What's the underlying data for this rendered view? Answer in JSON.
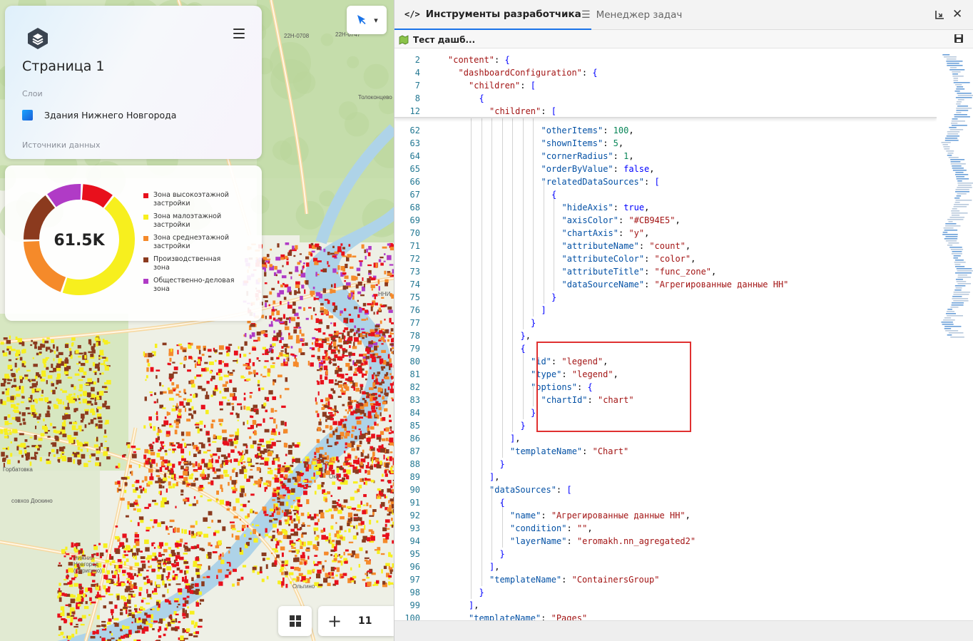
{
  "map": {
    "labels": [
      "22H-0708",
      "22H-0747",
      "Толоконцево",
      "Горбатовка",
      "совхоз Доскино",
      "Нижний Новгород (Стригино)",
      "Ока",
      "Ольгино",
      "ННИ"
    ]
  },
  "layers_panel": {
    "page_title": "Страница 1",
    "layers_label": "Слои",
    "layer_name": "Здания Нижнего Новгорода",
    "sources_label": "Источники данных"
  },
  "chart_panel": {
    "center_value": "61.5K",
    "chart_data": {
      "type": "pie",
      "title": "",
      "categories": [
        "Зона высокоэтажной застройки",
        "Зона малоэтажной застройки",
        "Зона среднеэтажной застройки",
        "Производственная зона",
        "Общественно-деловая зона"
      ],
      "values": [
        9,
        41,
        18,
        14,
        10
      ],
      "colors": [
        "#e8101c",
        "#f7ef1e",
        "#f58a2a",
        "#8b3a1e",
        "#b03bc6"
      ],
      "center_label": "61.5K"
    },
    "legend": [
      {
        "label": "Зона высокоэтажной застройки",
        "color": "#e8101c"
      },
      {
        "label": "Зона малоэтажной застройки",
        "color": "#f7ef1e"
      },
      {
        "label": "Зона среднеэтажной застройки",
        "color": "#f58a2a"
      },
      {
        "label": "Производственная зона",
        "color": "#8b3a1e"
      },
      {
        "label": "Общественно-деловая зона",
        "color": "#b03bc6"
      }
    ]
  },
  "map_controls": {
    "zoom_level": "11",
    "zoom_plus": "+",
    "tool_dropdown": "▾"
  },
  "devtools": {
    "tab_devtools": "Инструменты разработчика",
    "tab_tasks": "Менеджер задач",
    "file_tab": "Тест дашб...",
    "close": "✕"
  },
  "editor": {
    "sticky": [
      {
        "ln": "2",
        "ind": 2,
        "t": [
          [
            "s",
            "\"content\""
          ],
          [
            "p",
            ": "
          ],
          [
            "b",
            "{"
          ]
        ]
      },
      {
        "ln": "4",
        "ind": 3,
        "t": [
          [
            "s",
            "\"dashboardConfiguration\""
          ],
          [
            "p",
            ": "
          ],
          [
            "b",
            "{"
          ]
        ]
      },
      {
        "ln": "7",
        "ind": 4,
        "t": [
          [
            "s",
            "\"children\""
          ],
          [
            "p",
            ": "
          ],
          [
            "b",
            "["
          ]
        ]
      },
      {
        "ln": "8",
        "ind": 5,
        "t": [
          [
            "b",
            "{"
          ]
        ]
      },
      {
        "ln": "12",
        "ind": 6,
        "t": [
          [
            "s",
            "\"children\""
          ],
          [
            "p",
            ": "
          ],
          [
            "b",
            "["
          ]
        ]
      }
    ],
    "lines": [
      {
        "ln": "62",
        "ind": 11,
        "t": [
          [
            "k",
            "\"otherItems\""
          ],
          [
            "p",
            ": "
          ],
          [
            "n",
            "100"
          ],
          [
            "p",
            ","
          ]
        ]
      },
      {
        "ln": "63",
        "ind": 11,
        "t": [
          [
            "k",
            "\"shownItems\""
          ],
          [
            "p",
            ": "
          ],
          [
            "n",
            "5"
          ],
          [
            "p",
            ","
          ]
        ]
      },
      {
        "ln": "64",
        "ind": 11,
        "t": [
          [
            "k",
            "\"cornerRadius\""
          ],
          [
            "p",
            ": "
          ],
          [
            "n",
            "1"
          ],
          [
            "p",
            ","
          ]
        ]
      },
      {
        "ln": "65",
        "ind": 11,
        "t": [
          [
            "k",
            "\"orderByValue\""
          ],
          [
            "p",
            ": "
          ],
          [
            "b",
            "false"
          ],
          [
            "p",
            ","
          ]
        ]
      },
      {
        "ln": "66",
        "ind": 11,
        "t": [
          [
            "k",
            "\"relatedDataSources\""
          ],
          [
            "p",
            ": "
          ],
          [
            "b",
            "["
          ]
        ]
      },
      {
        "ln": "67",
        "ind": 12,
        "t": [
          [
            "b",
            "{"
          ]
        ]
      },
      {
        "ln": "68",
        "ind": 13,
        "t": [
          [
            "k",
            "\"hideAxis\""
          ],
          [
            "p",
            ": "
          ],
          [
            "b",
            "true"
          ],
          [
            "p",
            ","
          ]
        ]
      },
      {
        "ln": "69",
        "ind": 13,
        "t": [
          [
            "k",
            "\"axisColor\""
          ],
          [
            "p",
            ": "
          ],
          [
            "s",
            "\"#CB94E5\""
          ],
          [
            "p",
            ","
          ]
        ]
      },
      {
        "ln": "70",
        "ind": 13,
        "t": [
          [
            "k",
            "\"chartAxis\""
          ],
          [
            "p",
            ": "
          ],
          [
            "s",
            "\"y\""
          ],
          [
            "p",
            ","
          ]
        ]
      },
      {
        "ln": "71",
        "ind": 13,
        "t": [
          [
            "k",
            "\"attributeName\""
          ],
          [
            "p",
            ": "
          ],
          [
            "s",
            "\"count\""
          ],
          [
            "p",
            ","
          ]
        ]
      },
      {
        "ln": "72",
        "ind": 13,
        "t": [
          [
            "k",
            "\"attributeColor\""
          ],
          [
            "p",
            ": "
          ],
          [
            "s",
            "\"color\""
          ],
          [
            "p",
            ","
          ]
        ]
      },
      {
        "ln": "73",
        "ind": 13,
        "t": [
          [
            "k",
            "\"attributeTitle\""
          ],
          [
            "p",
            ": "
          ],
          [
            "s",
            "\"func_zone\""
          ],
          [
            "p",
            ","
          ]
        ]
      },
      {
        "ln": "74",
        "ind": 13,
        "t": [
          [
            "k",
            "\"dataSourceName\""
          ],
          [
            "p",
            ": "
          ],
          [
            "s",
            "\"Агрегированные данные НН\""
          ]
        ]
      },
      {
        "ln": "75",
        "ind": 12,
        "t": [
          [
            "b",
            "}"
          ]
        ]
      },
      {
        "ln": "76",
        "ind": 11,
        "t": [
          [
            "b",
            "]"
          ]
        ]
      },
      {
        "ln": "77",
        "ind": 10,
        "t": [
          [
            "b",
            "}"
          ]
        ]
      },
      {
        "ln": "78",
        "ind": 9,
        "t": [
          [
            "b",
            "}"
          ],
          [
            "p",
            ","
          ]
        ]
      },
      {
        "ln": "79",
        "ind": 9,
        "t": [
          [
            "b",
            "{"
          ]
        ]
      },
      {
        "ln": "80",
        "ind": 10,
        "t": [
          [
            "k",
            "\"id\""
          ],
          [
            "p",
            ": "
          ],
          [
            "s",
            "\"legend\""
          ],
          [
            "p",
            ","
          ]
        ]
      },
      {
        "ln": "81",
        "ind": 10,
        "t": [
          [
            "k",
            "\"type\""
          ],
          [
            "p",
            ": "
          ],
          [
            "s",
            "\"legend\""
          ],
          [
            "p",
            ","
          ]
        ]
      },
      {
        "ln": "82",
        "ind": 10,
        "t": [
          [
            "k",
            "\"options\""
          ],
          [
            "p",
            ": "
          ],
          [
            "b",
            "{"
          ]
        ]
      },
      {
        "ln": "83",
        "ind": 11,
        "t": [
          [
            "k",
            "\"chartId\""
          ],
          [
            "p",
            ": "
          ],
          [
            "s",
            "\"chart\""
          ]
        ]
      },
      {
        "ln": "84",
        "ind": 10,
        "t": [
          [
            "b",
            "}"
          ]
        ]
      },
      {
        "ln": "85",
        "ind": 9,
        "t": [
          [
            "b",
            "}"
          ]
        ]
      },
      {
        "ln": "86",
        "ind": 8,
        "t": [
          [
            "b",
            "]"
          ],
          [
            "p",
            ","
          ]
        ]
      },
      {
        "ln": "87",
        "ind": 8,
        "t": [
          [
            "k",
            "\"templateName\""
          ],
          [
            "p",
            ": "
          ],
          [
            "s",
            "\"Chart\""
          ]
        ]
      },
      {
        "ln": "88",
        "ind": 7,
        "t": [
          [
            "b",
            "}"
          ]
        ]
      },
      {
        "ln": "89",
        "ind": 6,
        "t": [
          [
            "b",
            "]"
          ],
          [
            "p",
            ","
          ]
        ]
      },
      {
        "ln": "90",
        "ind": 6,
        "t": [
          [
            "k",
            "\"dataSources\""
          ],
          [
            "p",
            ": "
          ],
          [
            "b",
            "["
          ]
        ]
      },
      {
        "ln": "91",
        "ind": 7,
        "t": [
          [
            "b",
            "{"
          ]
        ]
      },
      {
        "ln": "92",
        "ind": 8,
        "t": [
          [
            "k",
            "\"name\""
          ],
          [
            "p",
            ": "
          ],
          [
            "s",
            "\"Агрегированные данные НН\""
          ],
          [
            "p",
            ","
          ]
        ]
      },
      {
        "ln": "93",
        "ind": 8,
        "t": [
          [
            "k",
            "\"condition\""
          ],
          [
            "p",
            ": "
          ],
          [
            "s",
            "\"\""
          ],
          [
            "p",
            ","
          ]
        ]
      },
      {
        "ln": "94",
        "ind": 8,
        "t": [
          [
            "k",
            "\"layerName\""
          ],
          [
            "p",
            ": "
          ],
          [
            "s",
            "\"eromakh.nn_agregated2\""
          ]
        ]
      },
      {
        "ln": "95",
        "ind": 7,
        "t": [
          [
            "b",
            "}"
          ]
        ]
      },
      {
        "ln": "96",
        "ind": 6,
        "t": [
          [
            "b",
            "]"
          ],
          [
            "p",
            ","
          ]
        ]
      },
      {
        "ln": "97",
        "ind": 6,
        "t": [
          [
            "k",
            "\"templateName\""
          ],
          [
            "p",
            ": "
          ],
          [
            "s",
            "\"ContainersGroup\""
          ]
        ]
      },
      {
        "ln": "98",
        "ind": 5,
        "t": [
          [
            "b",
            "}"
          ]
        ]
      },
      {
        "ln": "99",
        "ind": 4,
        "t": [
          [
            "b",
            "]"
          ],
          [
            "p",
            ","
          ]
        ]
      },
      {
        "ln": "100",
        "ind": 4,
        "t": [
          [
            "k",
            "\"templateName\""
          ],
          [
            "p",
            ": "
          ],
          [
            "s",
            "\"Pages\""
          ]
        ]
      }
    ]
  }
}
